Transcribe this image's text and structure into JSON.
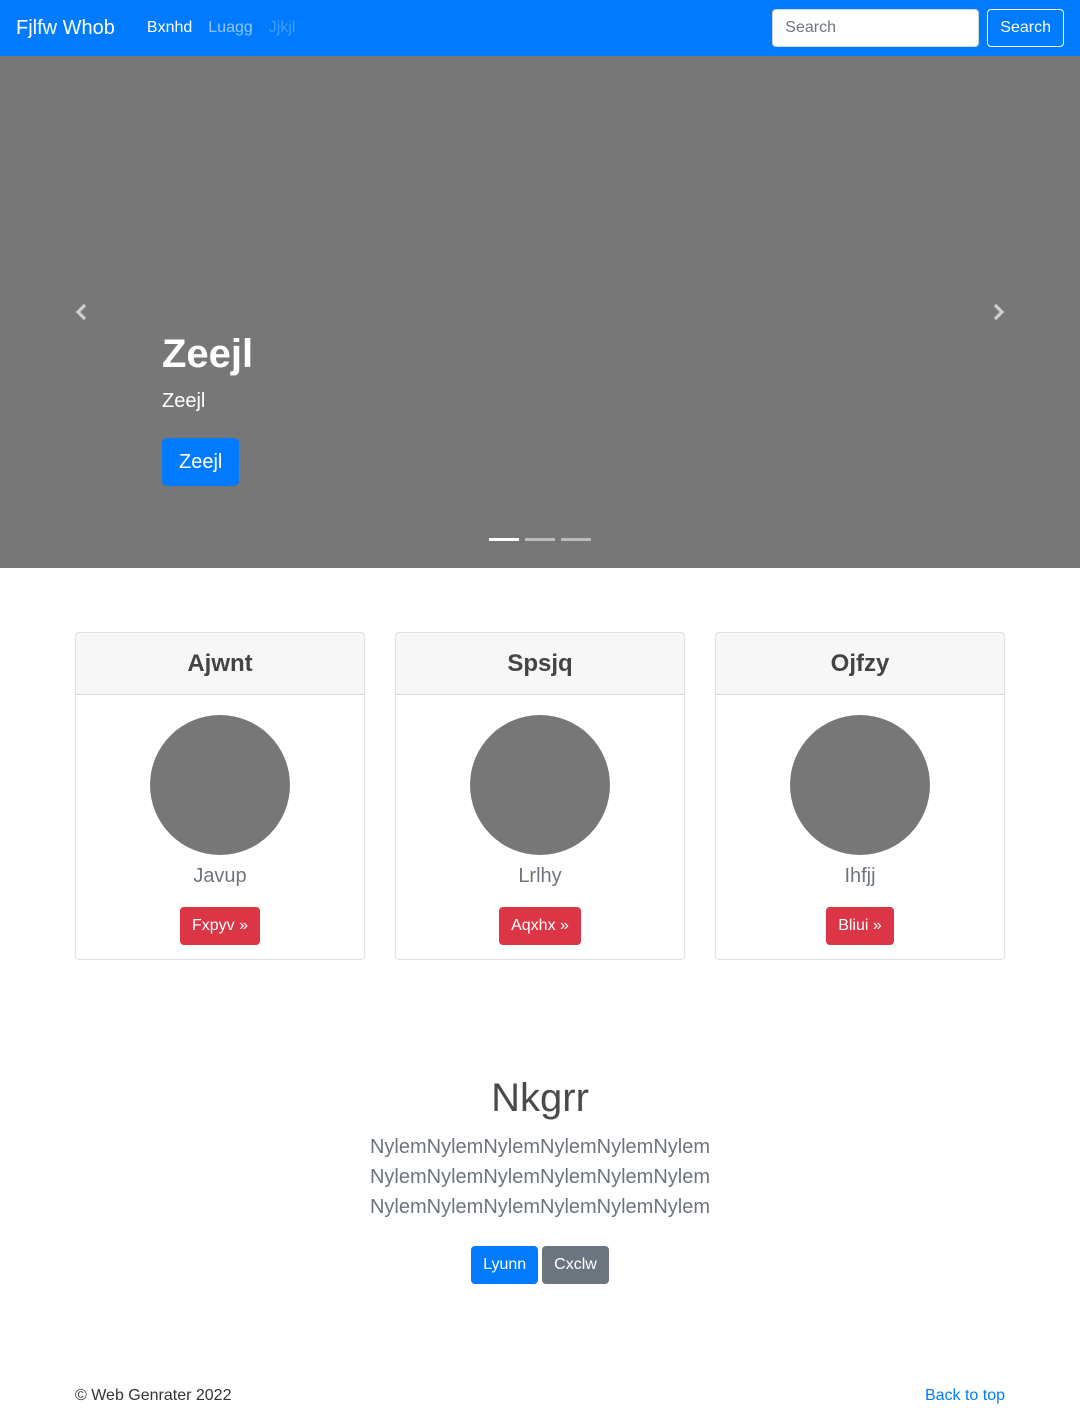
{
  "colors": {
    "primary": "#007bff",
    "danger": "#dc3545",
    "secondary": "#6c757d",
    "placeholder_gray": "#777777"
  },
  "navbar": {
    "brand": "Fjlfw Whob",
    "links": [
      {
        "label": "Bxnhd",
        "state": "active"
      },
      {
        "label": "Luagg",
        "state": "normal"
      },
      {
        "label": "Jjkjl",
        "state": "disabled"
      }
    ],
    "search": {
      "placeholder": "Search",
      "button_label": "Search"
    }
  },
  "carousel": {
    "prev_icon": "chevron-left-icon",
    "next_icon": "chevron-right-icon",
    "slide": {
      "title": "Zeejl",
      "text": "Zeejl",
      "button_label": "Zeejl"
    },
    "indicator_count": 3,
    "active_indicator": 1
  },
  "cards": [
    {
      "header": "Ajwnt",
      "text": "Javup",
      "button_label": "Fxpyv »"
    },
    {
      "header": "Spsjq",
      "text": "Lrlhy",
      "button_label": "Aqxhx »"
    },
    {
      "header": "Ojfzy",
      "text": "Ihfjj",
      "button_label": "Bliui »"
    }
  ],
  "jumbotron": {
    "title": "Nkgrr",
    "lines": [
      "NylemNylemNylemNylemNylemNylem",
      "NylemNylemNylemNylemNylemNylem",
      "NylemNylemNylemNylemNylemNylem"
    ],
    "primary_button": "Lyunn",
    "secondary_button": "Cxclw"
  },
  "footer": {
    "copyright": "© Web Genrater 2022",
    "back_to_top": "Back to top"
  }
}
